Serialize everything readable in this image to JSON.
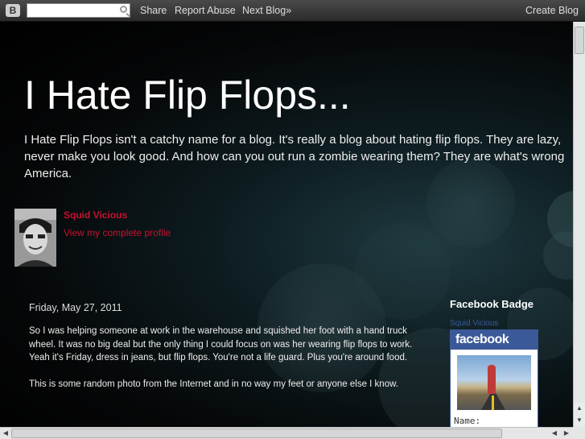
{
  "navbar": {
    "search_placeholder": "",
    "links": [
      "Share",
      "Report Abuse",
      "Next Blog»"
    ],
    "create_blog": "Create Blog"
  },
  "blog": {
    "title": "I Hate Flip Flops...",
    "description_lines": [
      "I Hate Flip Flops isn't a catchy name for a blog. It's really a blog about hating flip flops. They are lazy,",
      "never make you look good. And how can you out run a zombie wearing them? They are what's wrong",
      "America."
    ]
  },
  "profile": {
    "name": "Squid Vicious",
    "view_profile": "View my complete profile"
  },
  "post": {
    "date": "Friday, May 27, 2011",
    "paragraphs": [
      "So I was helping someone at work in the warehouse and squished her foot with a hand truck wheel. It was no big deal but the only thing I could focus on was her wearing flip flops to work. Yeah it's Friday, dress in jeans, but flip flops. You're not a life guard. Plus you're around food.",
      "This is some random photo from the Internet and in no way my feet or anyone else I know."
    ]
  },
  "sidebar": {
    "title": "Facebook Badge",
    "badge_name": "Squid Vicious",
    "badge_header": "facebook",
    "name_label": "Name:"
  },
  "colors": {
    "link_red": "#c8102e",
    "facebook_blue": "#3b5998"
  }
}
